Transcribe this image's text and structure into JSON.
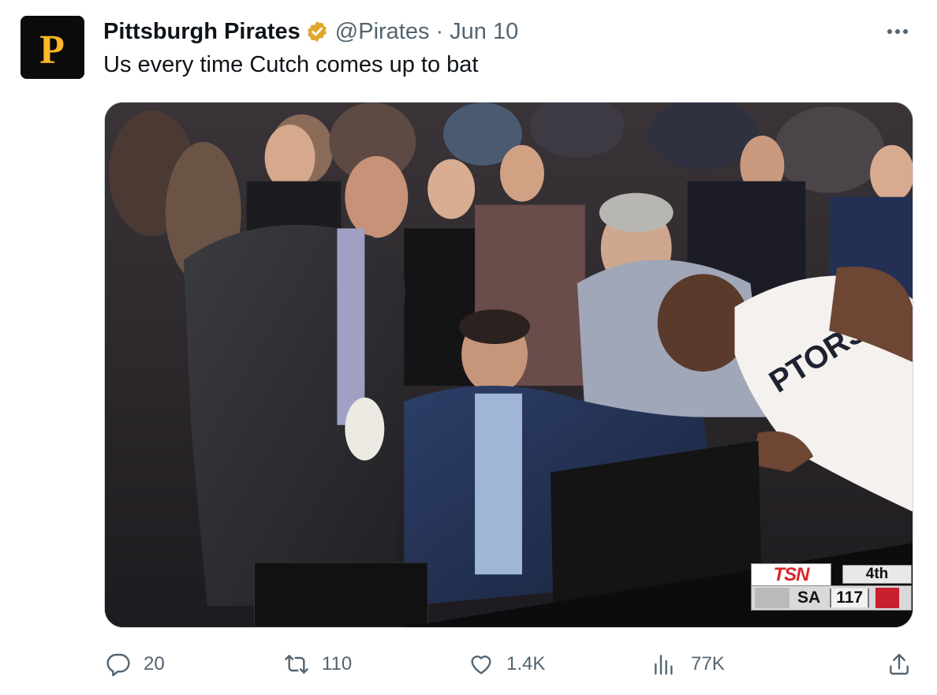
{
  "tweet": {
    "author_name": "Pittsburgh Pirates",
    "handle": "@Pirates",
    "separator": "·",
    "date": "Jun 10",
    "text": "Us every time Cutch comes up to bat",
    "avatar_letter": "P",
    "verified": true,
    "verified_color": "#e0a72a",
    "brand_color": "#fdb827"
  },
  "media": {
    "jersey_text": "PTORS",
    "scoreboard": {
      "network": "TSN",
      "quarter": "4th",
      "team": "SA",
      "score": "117"
    }
  },
  "actions": {
    "reply_count": "20",
    "retweet_count": "110",
    "like_count": "1.4K",
    "views_count": "77K"
  },
  "icons": [
    "more-icon",
    "verified-badge-icon",
    "reply-icon",
    "retweet-icon",
    "like-icon",
    "views-icon",
    "share-icon"
  ]
}
